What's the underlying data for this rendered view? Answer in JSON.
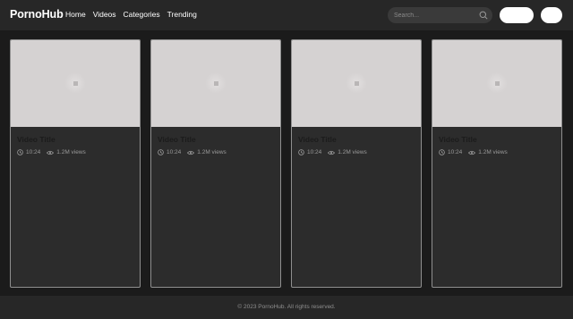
{
  "header": {
    "logo": "PornoHub",
    "nav": [
      "Home",
      "Videos",
      "Categories",
      "Trending"
    ],
    "search_placeholder": "Search..."
  },
  "videos": [
    {
      "title": "Video Title",
      "duration": "10:24",
      "views": "1.2M views"
    },
    {
      "title": "Video Title",
      "duration": "10:24",
      "views": "1.2M views"
    },
    {
      "title": "Video Title",
      "duration": "10:24",
      "views": "1.2M views"
    },
    {
      "title": "Video Title",
      "duration": "10:24",
      "views": "1.2M views"
    }
  ],
  "footer": {
    "copyright": "© 2023 PornoHub. All rights reserved."
  },
  "icons": {
    "search": "search-icon",
    "duration": "clock-icon",
    "views": "eye-icon"
  },
  "colors": {
    "header_bg": "#272727",
    "page_bg": "#1b1b1b",
    "card_bg": "#2c2c2c",
    "thumbnail_bg": "#d5d2d2"
  }
}
